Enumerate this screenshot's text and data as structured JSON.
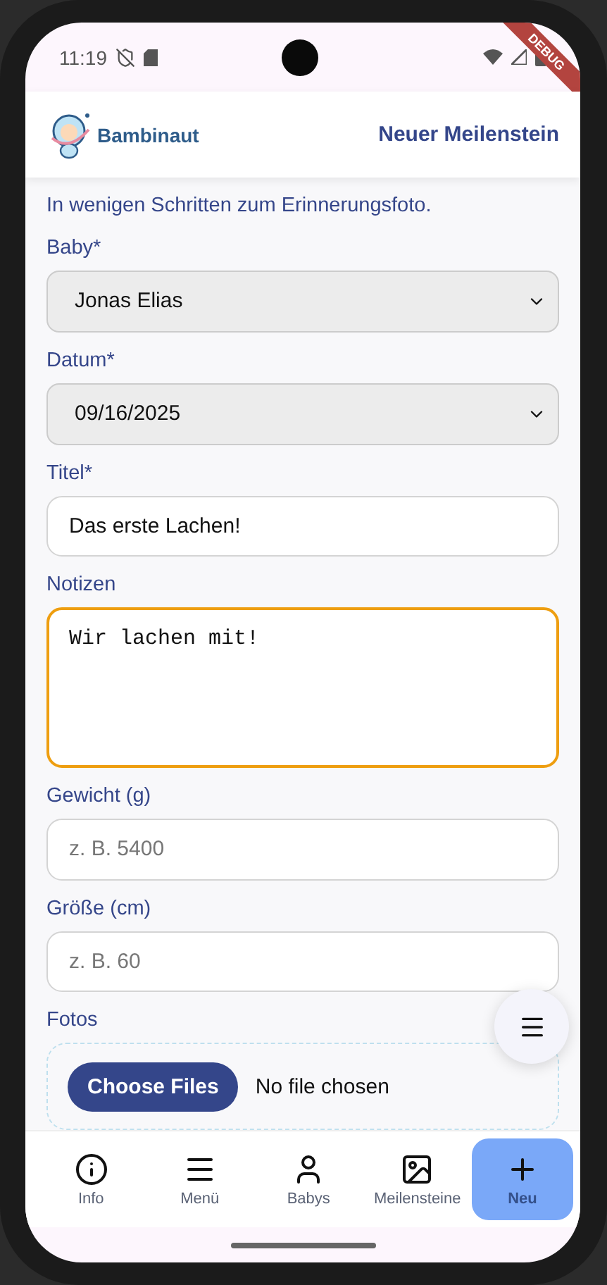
{
  "status_bar": {
    "time": "11:19",
    "debug": "DEBUG"
  },
  "header": {
    "brand": "Bambinaut",
    "title": "Neuer Meilenstein"
  },
  "intro": "In wenigen Schritten zum Erinnerungsfoto.",
  "fields": [
    {
      "kind": "select",
      "label": "Baby*",
      "value": "Jonas Elias"
    },
    {
      "kind": "select",
      "label": "Datum*",
      "value": "09/16/2025"
    },
    {
      "kind": "text",
      "label": "Titel*",
      "value": "Das erste Lachen!"
    },
    {
      "kind": "textarea",
      "label": "Notizen",
      "value": "Wir lachen mit!",
      "focused": true
    },
    {
      "kind": "text",
      "label": "Gewicht (g)",
      "placeholder": "z. B. 5400"
    },
    {
      "kind": "text",
      "label": "Größe (cm)",
      "placeholder": "z. B. 60"
    },
    {
      "kind": "file",
      "label": "Fotos",
      "button": "Choose Files",
      "status": "No file chosen"
    }
  ],
  "nav": [
    {
      "kind": "info",
      "label": "Info",
      "selected": false
    },
    {
      "kind": "menu",
      "label": "Menü",
      "selected": false
    },
    {
      "kind": "person",
      "label": "Babys",
      "selected": false
    },
    {
      "kind": "image",
      "label": "Meilensteine",
      "selected": false
    },
    {
      "kind": "plus",
      "label": "Neu",
      "selected": true
    }
  ]
}
